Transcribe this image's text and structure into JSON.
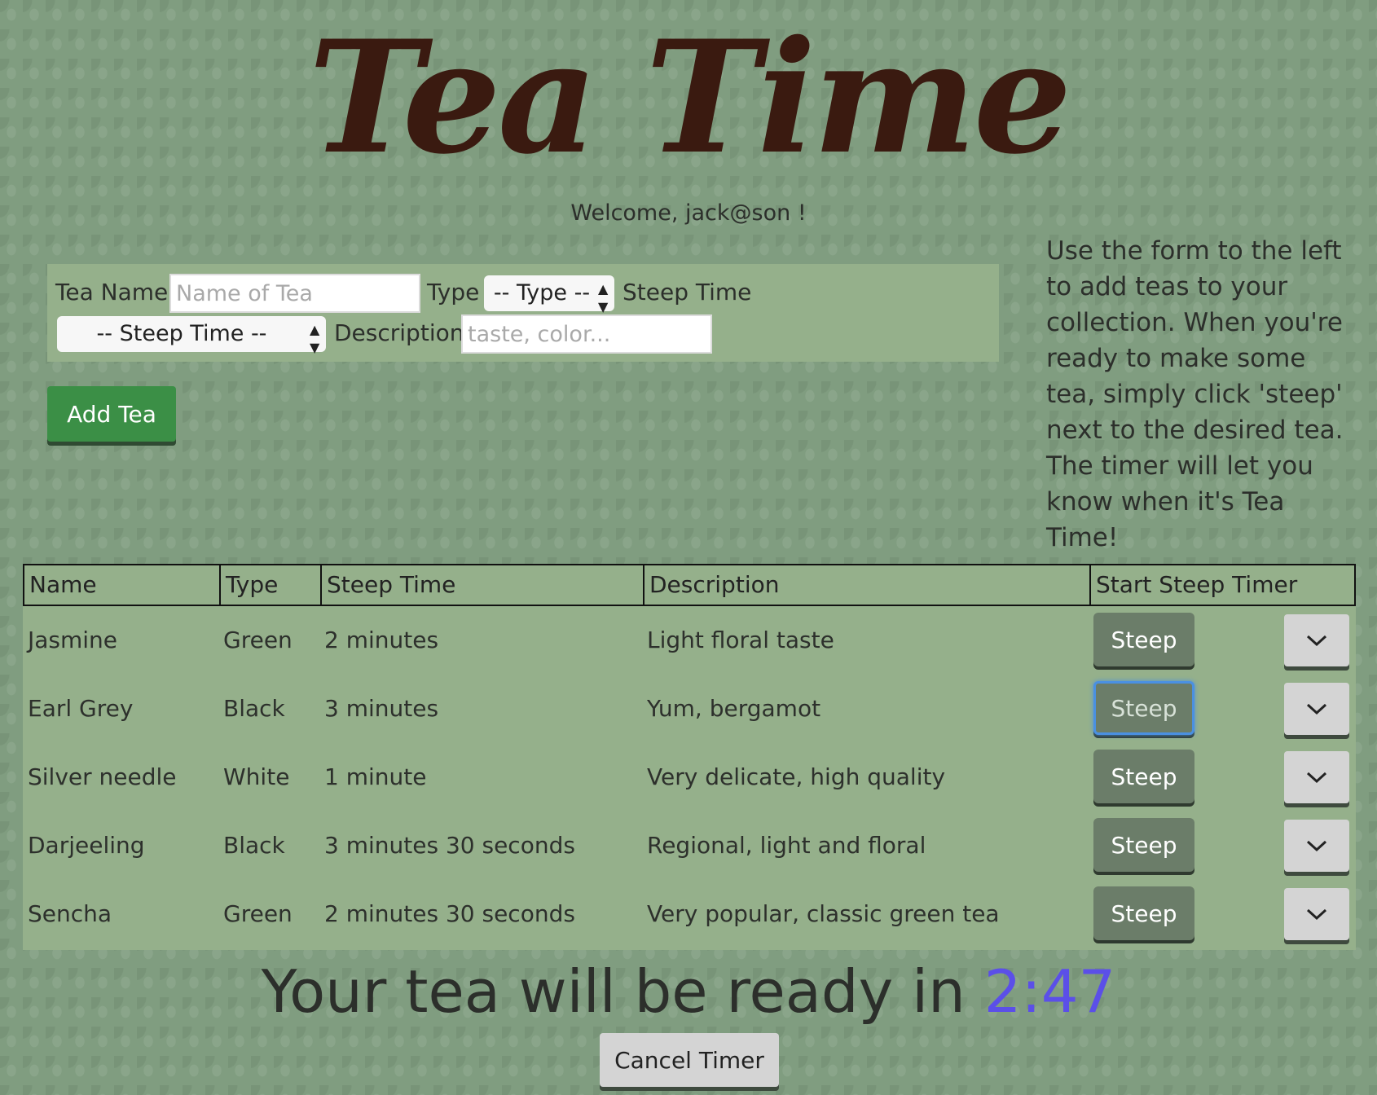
{
  "header": {
    "title": "Tea Time",
    "welcome": "Welcome, jack@son !"
  },
  "form": {
    "tea_name_label": "Tea Name",
    "tea_name_placeholder": "Name of Tea",
    "type_label": "Type",
    "type_selected": "-- Type --",
    "steep_time_label": "Steep Time",
    "steep_time_selected": "-- Steep Time --",
    "description_label": "Description",
    "description_placeholder": "taste, color...",
    "add_button": "Add Tea"
  },
  "help_text": "Use the form to the left to add teas to your collection. When you're ready to make some tea, simply click 'steep' next to the desired tea. The timer will let you know when it's Tea Time!",
  "table": {
    "headers": [
      "Name",
      "Type",
      "Steep Time",
      "Description",
      "Start Steep Timer"
    ],
    "steep_label": "Steep",
    "rows": [
      {
        "name": "Jasmine",
        "type": "Green",
        "steep": "2 minutes",
        "description": "Light floral taste"
      },
      {
        "name": "Earl Grey",
        "type": "Black",
        "steep": "3 minutes",
        "description": "Yum, bergamot"
      },
      {
        "name": "Silver needle",
        "type": "White",
        "steep": "1 minute",
        "description": "Very delicate, high quality"
      },
      {
        "name": "Darjeeling",
        "type": "Black",
        "steep": "3 minutes 30 seconds",
        "description": "Regional, light and floral"
      },
      {
        "name": "Sencha",
        "type": "Green",
        "steep": "2 minutes 30 seconds",
        "description": "Very popular, classic green tea"
      }
    ]
  },
  "timer": {
    "prefix": "Your tea will be ready in",
    "value": "2:47",
    "cancel_button": "Cancel Timer"
  },
  "colors": {
    "accent_timer": "#5b4fe8",
    "add_button": "#3b8f46",
    "title": "#3a1a10",
    "focus_ring": "#4a90e2"
  },
  "icons": {
    "row_expand": "chevron-down-icon",
    "select_arrow": "select-arrows-icon"
  }
}
